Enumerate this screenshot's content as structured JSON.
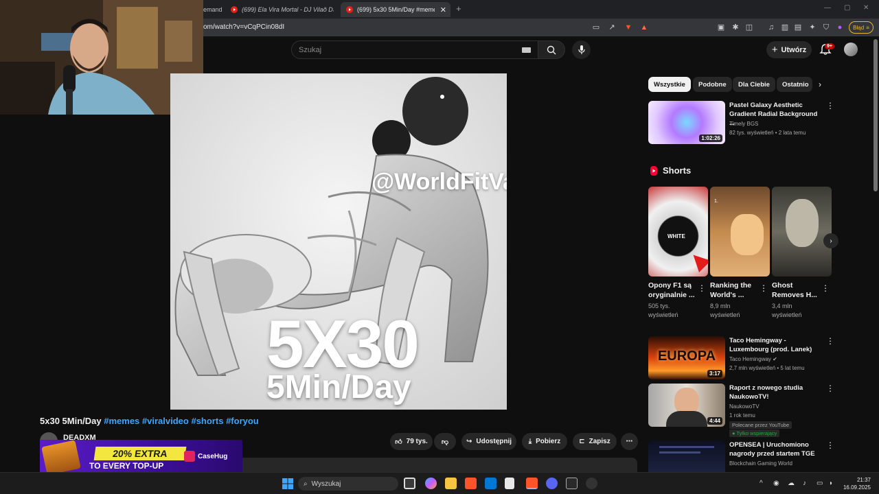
{
  "browser": {
    "tabs": [
      {
        "label": "emand"
      },
      {
        "label": "(699) Ela Vira Mortal - DJ Vilaõ DS"
      },
      {
        "label": "(699) 5x30 5Min/Day #memes #"
      }
    ],
    "url": "om/watch?v=vCqPCin08dI",
    "error_label": "Błąd"
  },
  "masthead": {
    "search_placeholder": "Szukaj",
    "create_label": "Utwórz",
    "notifications_badge": "9+"
  },
  "video": {
    "watermark": "@WorldFitVa",
    "overlay_big": "5X30",
    "overlay_small": "5Min/Day",
    "title_main": "5x30 5Min/Day",
    "hashtags": [
      "#memes",
      "#viralvideo",
      "#shorts",
      "#foryou"
    ],
    "channel": "DEADXM",
    "likes": "79 tys.",
    "share_label": "Udostępnij",
    "download_label": "Pobierz",
    "save_label": "Zapisz"
  },
  "ad": {
    "line1": "20% EXTRA",
    "line2": "TO EVERY TOP-UP",
    "brand": "CaseHug"
  },
  "chips": [
    "Wszystkie",
    "Podobne",
    "Dla Ciebie",
    "Ostatnio"
  ],
  "recommended_top": {
    "title": "Pastel Galaxy Aesthetic Gradient Radial Background ...",
    "channel": "Timely BGS",
    "meta": "82 tys. wyświetleń • 2 lata temu",
    "duration": "1:02:26"
  },
  "shorts": {
    "heading": "Shorts",
    "items": [
      {
        "title": "Opony F1 są oryginalnie ...",
        "views": "505 tys.",
        "views_label": "wyświetleń",
        "thumb_text": "WHITE"
      },
      {
        "title": "Ranking the World's ...",
        "views": "8,9 mln",
        "views_label": "wyświetleń",
        "thumb_text": "1."
      },
      {
        "title": "Ghost Removes H...",
        "views": "3,4 mln",
        "views_label": "wyświetleń",
        "thumb_text": ""
      }
    ]
  },
  "recommended": [
    {
      "title": "Taco Hemingway - Luxembourg (prod. Lanek)",
      "channel": "Taco Hemingway",
      "meta": "2,7 mln wyświetleń • 5 lat temu",
      "duration": "3:17",
      "thumb_text": "EUROPA"
    },
    {
      "title": "Raport z nowego studia NaukowoTV!",
      "channel": "NaukowoTV",
      "meta": "1 rok temu",
      "duration": "4:44",
      "badge1": "Polecane przez YouTube",
      "badge2": "Tylko wspierający"
    },
    {
      "title": "OPENSEA | Uruchomiono nagrody przed startem TGE",
      "channel": "Blockchain Gaming World"
    }
  ],
  "taskbar": {
    "search_label": "Wyszukaj",
    "time": "21:37",
    "date": "16.09.2025"
  },
  "colors": {
    "background": "#0f0f0f",
    "link": "#3ea6ff",
    "youtube_red": "#ff0000",
    "ad_purple": "#5a1cc7",
    "ad_yellow": "#f3e63e"
  }
}
